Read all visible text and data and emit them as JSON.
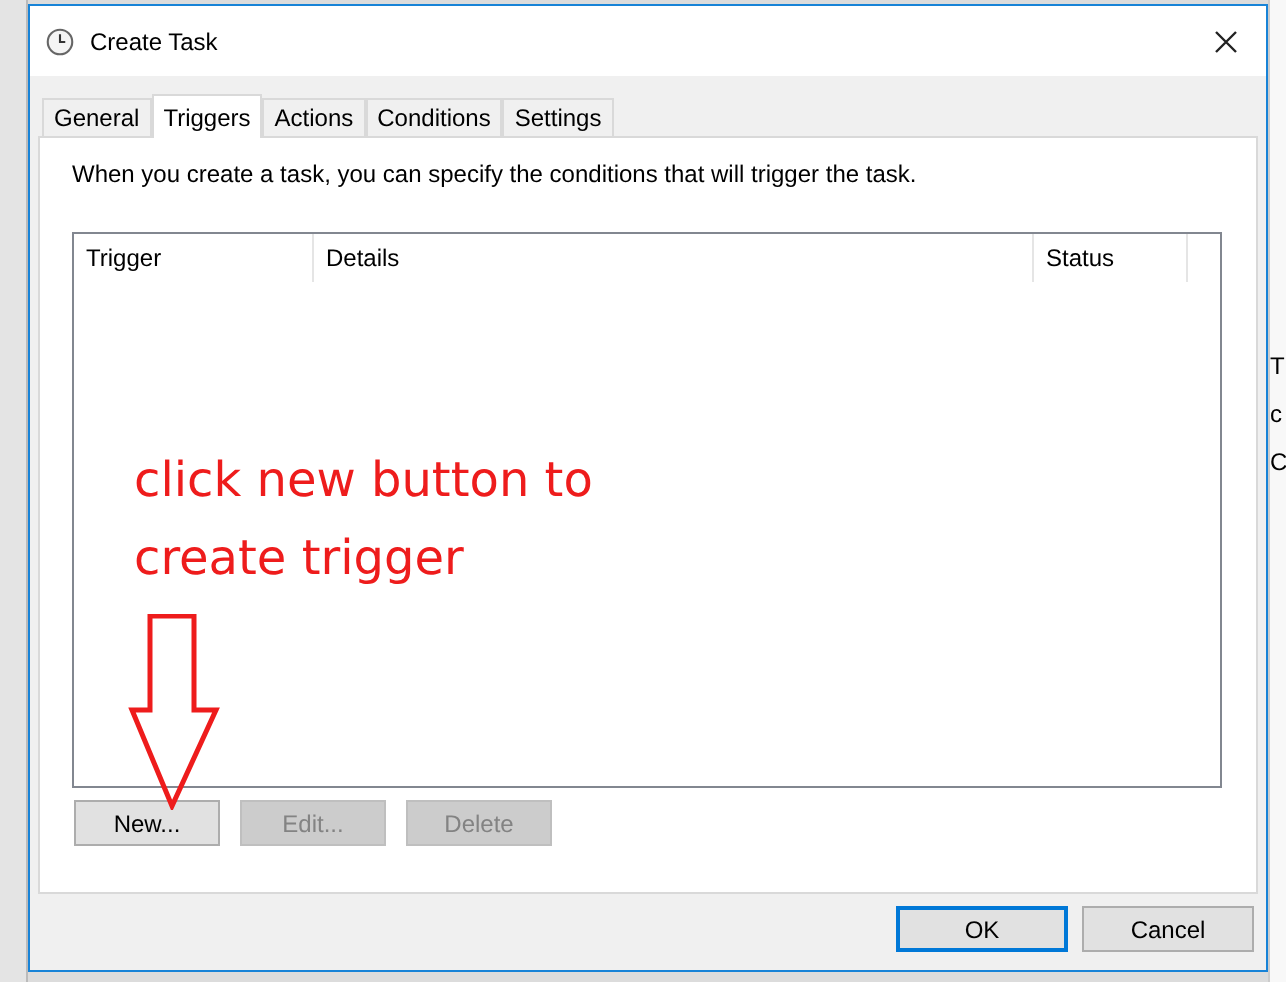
{
  "window": {
    "title": "Create Task"
  },
  "tabs": [
    {
      "label": "General",
      "selected": false
    },
    {
      "label": "Triggers",
      "selected": true
    },
    {
      "label": "Actions",
      "selected": false
    },
    {
      "label": "Conditions",
      "selected": false
    },
    {
      "label": "Settings",
      "selected": false
    }
  ],
  "description": "When you create a task, you can specify the conditions that will trigger the task.",
  "table": {
    "columns": [
      "Trigger",
      "Details",
      "Status"
    ]
  },
  "list_buttons": [
    {
      "label": "New...",
      "disabled": false
    },
    {
      "label": "Edit...",
      "disabled": true
    },
    {
      "label": "Delete",
      "disabled": true
    }
  ],
  "annotation": {
    "text": "click new button to create trigger"
  },
  "dialog_buttons": [
    {
      "label": "OK",
      "default": true
    },
    {
      "label": "Cancel",
      "default": false
    }
  ],
  "background_letters": [
    "T",
    "c",
    "C"
  ]
}
